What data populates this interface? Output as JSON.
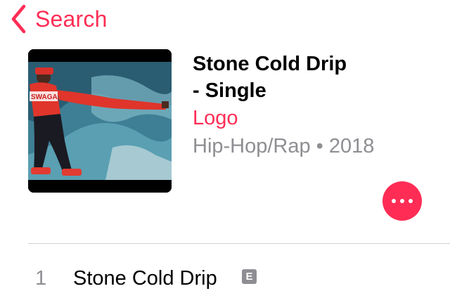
{
  "nav": {
    "back_label": "Search"
  },
  "album": {
    "title": "Stone Cold Drip\n- Single",
    "artist": "Logo",
    "meta": "Hip-Hop/Rap • 2018",
    "artwork_icon": "album-artwork"
  },
  "actions": {
    "more_icon": "ellipsis-icon"
  },
  "tracks": [
    {
      "number": "1",
      "title": "Stone Cold Drip",
      "badge": "E"
    }
  ],
  "colors": {
    "accent": "#ff2d55",
    "secondary_text": "#8e8e93",
    "divider": "#d1d1d6"
  }
}
